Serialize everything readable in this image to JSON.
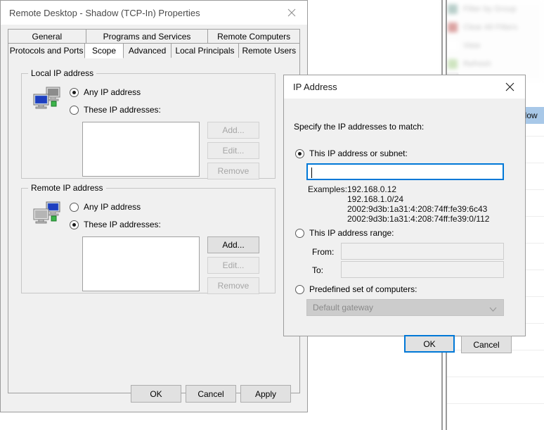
{
  "background": {
    "menu_items": [
      {
        "label": "Filter by Group",
        "color": "#7fa8a0"
      },
      {
        "label": "Clear All Filters",
        "color": "#c05a58"
      },
      {
        "label": "View",
        "color": "#ffffff"
      },
      {
        "label": "Refresh",
        "color": "#a7d08c"
      }
    ],
    "selected_row_text": "adow",
    "selected_row_color": "#a8c8e8"
  },
  "properties_window": {
    "title": "Remote Desktop - Shadow (TCP-In) Properties",
    "close_icon": "close-icon",
    "tabs_row1": [
      {
        "label": "General",
        "active": false
      },
      {
        "label": "Programs and Services",
        "active": false
      },
      {
        "label": "Remote Computers",
        "active": false
      }
    ],
    "tabs_row2": [
      {
        "label": "Protocols and Ports",
        "active": false
      },
      {
        "label": "Scope",
        "active": true
      },
      {
        "label": "Advanced",
        "active": false
      },
      {
        "label": "Local Principals",
        "active": false
      },
      {
        "label": "Remote Users",
        "active": false
      }
    ],
    "local_group": {
      "title": "Local IP address",
      "icon": "local-computers-icon",
      "option_any": "Any IP address",
      "option_these": "These IP addresses:",
      "selected": "any",
      "list_items": [],
      "buttons": [
        {
          "label": "Add...",
          "enabled": false
        },
        {
          "label": "Edit...",
          "enabled": false
        },
        {
          "label": "Remove",
          "enabled": false
        }
      ]
    },
    "remote_group": {
      "title": "Remote IP address",
      "icon": "remote-computers-icon",
      "option_any": "Any IP address",
      "option_these": "These IP addresses:",
      "selected": "these",
      "list_items": [],
      "buttons": [
        {
          "label": "Add...",
          "enabled": true
        },
        {
          "label": "Edit...",
          "enabled": false
        },
        {
          "label": "Remove",
          "enabled": false
        }
      ]
    },
    "footer": {
      "ok": "OK",
      "cancel": "Cancel",
      "apply": "Apply"
    }
  },
  "ip_dialog": {
    "title": "IP Address",
    "close_icon": "close-icon",
    "instruction": "Specify the IP addresses to match:",
    "option_subnet": {
      "label": "This IP address or subnet:",
      "selected": true,
      "value": "",
      "examples_label": "Examples:",
      "examples": "192.168.0.12\n192.168.1.0/24\n2002:9d3b:1a31:4:208:74ff:fe39:6c43\n2002:9d3b:1a31:4:208:74ff:fe39:0/112"
    },
    "option_range": {
      "label": "This IP address range:",
      "selected": false,
      "from_label": "From:",
      "from_value": "",
      "to_label": "To:",
      "to_value": ""
    },
    "option_predefined": {
      "label": "Predefined set of computers:",
      "selected": false,
      "combo_value": "Default gateway",
      "combo_icon": "chevron-down-icon"
    },
    "buttons": {
      "ok": "OK",
      "cancel": "Cancel"
    }
  },
  "colors": {
    "accent": "#0078d7",
    "dialog_face": "#f0f0f0",
    "selection": "#a8c8e8"
  }
}
